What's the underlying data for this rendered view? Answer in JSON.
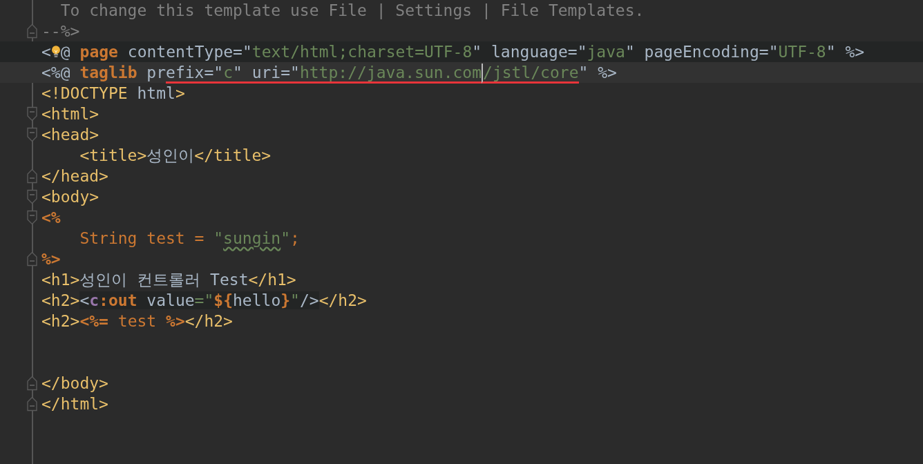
{
  "editor": {
    "lines": [
      {
        "tokens": [
          {
            "text": "  To change this template use File | Settings | File Templates.",
            "kind": "comment"
          }
        ]
      },
      {
        "fold_end": true,
        "tokens": [
          {
            "text": "--%>",
            "kind": "comment"
          }
        ]
      },
      {
        "injected": true,
        "tokens": [
          {
            "text": "<",
            "kind": "plain"
          },
          {
            "kind": "lightbulb"
          },
          {
            "text": "@ ",
            "kind": "plain"
          },
          {
            "text": "page",
            "kind": "keyword"
          },
          {
            "text": " contentType=",
            "kind": "plain"
          },
          {
            "text": "\"",
            "kind": "plain"
          },
          {
            "text": "text/html;charset=UTF-8",
            "kind": "string"
          },
          {
            "text": "\" language=",
            "kind": "plain"
          },
          {
            "text": "\"",
            "kind": "plain"
          },
          {
            "text": "java",
            "kind": "string"
          },
          {
            "text": "\" pageEncoding=",
            "kind": "plain"
          },
          {
            "text": "\"",
            "kind": "plain"
          },
          {
            "text": "UTF-8",
            "kind": "string"
          },
          {
            "text": "\" %>",
            "kind": "plain"
          }
        ]
      },
      {
        "caret_line": true,
        "tokens": [
          {
            "text": "<%@ ",
            "kind": "plain"
          },
          {
            "text": "taglib",
            "kind": "keyword"
          },
          {
            "text": " pr",
            "kind": "plain"
          },
          {
            "text": "efix=\"",
            "kind": "plain",
            "underline": true
          },
          {
            "text": "c",
            "kind": "string",
            "underline": true
          },
          {
            "text": "\" uri=\"",
            "kind": "plain",
            "underline": true
          },
          {
            "text": "http://java.sun.com",
            "kind": "string",
            "underline": true
          },
          {
            "text": "/jstl/core",
            "kind": "string",
            "underline": true,
            "caret_before": true
          },
          {
            "text": "\" %>",
            "kind": "plain"
          }
        ]
      },
      {
        "tokens": [
          {
            "text": "<!DOCTYPE ",
            "kind": "tag"
          },
          {
            "text": "html",
            "kind": "plain"
          },
          {
            "text": ">",
            "kind": "tag"
          }
        ]
      },
      {
        "fold_start": true,
        "tokens": [
          {
            "text": "<html>",
            "kind": "tag"
          }
        ]
      },
      {
        "fold_start": true,
        "tokens": [
          {
            "text": "<head>",
            "kind": "tag"
          }
        ]
      },
      {
        "tokens": [
          {
            "text": "    <title>",
            "kind": "tag"
          },
          {
            "text": "성인이",
            "kind": "plain"
          },
          {
            "text": "</title>",
            "kind": "tag"
          }
        ]
      },
      {
        "fold_end": true,
        "tokens": [
          {
            "text": "</head>",
            "kind": "tag"
          }
        ]
      },
      {
        "fold_start": true,
        "tokens": [
          {
            "text": "<body>",
            "kind": "tag"
          }
        ]
      },
      {
        "fold_start": true,
        "tokens": [
          {
            "text": "<%",
            "kind": "keyword"
          }
        ]
      },
      {
        "tokens": [
          {
            "text": "    String test = ",
            "kind": "java"
          },
          {
            "text": "\"",
            "kind": "string"
          },
          {
            "text": "sungin",
            "kind": "string",
            "typo": true
          },
          {
            "text": "\"",
            "kind": "string"
          },
          {
            "text": ";",
            "kind": "java"
          }
        ]
      },
      {
        "fold_end": true,
        "tokens": [
          {
            "text": "%>",
            "kind": "keyword"
          }
        ]
      },
      {
        "tokens": [
          {
            "text": "<h1>",
            "kind": "tag"
          },
          {
            "text": "성인이 컨트롤러 Test",
            "kind": "plain"
          },
          {
            "text": "</h1>",
            "kind": "tag"
          }
        ]
      },
      {
        "tokens": [
          {
            "text": "<h2>",
            "kind": "tag"
          },
          {
            "text": "<",
            "kind": "plain",
            "highlight": true
          },
          {
            "text": "c",
            "kind": "prefix",
            "highlight": true
          },
          {
            "text": ":out",
            "kind": "keyword",
            "highlight": true
          },
          {
            "text": " value",
            "kind": "plain",
            "highlight": true
          },
          {
            "text": "=\"",
            "kind": "string",
            "highlight": true
          },
          {
            "text": "${",
            "kind": "keyword",
            "highlight": true
          },
          {
            "text": "hello",
            "kind": "plain",
            "highlight": true
          },
          {
            "text": "}",
            "kind": "keyword",
            "highlight": true
          },
          {
            "text": "\"",
            "kind": "string",
            "highlight": true
          },
          {
            "text": "/>",
            "kind": "plain",
            "highlight": true
          },
          {
            "text": "</h2>",
            "kind": "tag"
          }
        ]
      },
      {
        "tokens": [
          {
            "text": "<h2>",
            "kind": "tag"
          },
          {
            "text": "<%=",
            "kind": "keyword"
          },
          {
            "text": " test ",
            "kind": "java"
          },
          {
            "text": "%>",
            "kind": "keyword"
          },
          {
            "text": "</h2>",
            "kind": "tag"
          }
        ]
      },
      {
        "after_blank_lines": true,
        "fold_end": true,
        "tokens": [
          {
            "text": "</body>",
            "kind": "tag"
          }
        ]
      },
      {
        "fold_end": true,
        "tokens": [
          {
            "text": "</html>",
            "kind": "tag"
          }
        ]
      }
    ]
  }
}
